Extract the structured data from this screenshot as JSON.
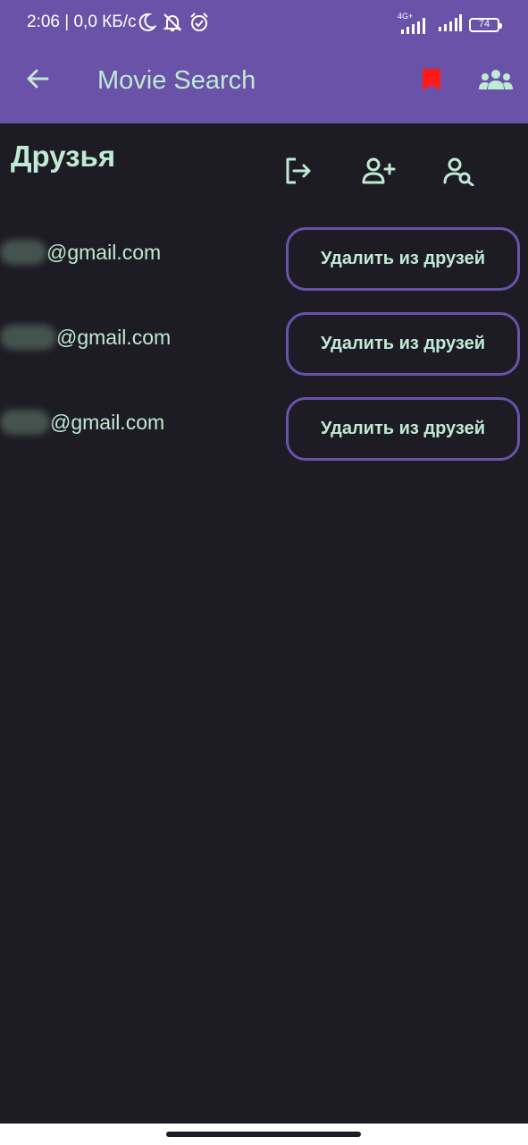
{
  "status_bar": {
    "time_text": "2:06 | 0,0 КБ/с",
    "network_label": "4G+",
    "battery_level": "74",
    "icons": [
      "moon-icon",
      "bell-off-icon",
      "alarm-icon",
      "signal-4g-icon",
      "signal-icon",
      "battery-icon"
    ]
  },
  "app_bar": {
    "title": "Movie Search",
    "icons": [
      "arrow-left-icon",
      "bookmark-icon",
      "group-icon"
    ]
  },
  "friends": {
    "title": "Друзья",
    "action_icons": [
      "logout-icon",
      "person-add-icon",
      "person-search-icon"
    ],
    "items": [
      {
        "email": "@gmail.com",
        "remove_label": "Удалить из друзей"
      },
      {
        "email": "@gmail.com",
        "remove_label": "Удалить из друзей"
      },
      {
        "email": "@gmail.com",
        "remove_label": "Удалить из друзей"
      }
    ]
  },
  "colors": {
    "app_bar": "#6952a8",
    "background": "#1d1b23",
    "accent_text": "#bfead3",
    "bookmark": "#ff1a1a",
    "button_border": "#6a52aa"
  }
}
